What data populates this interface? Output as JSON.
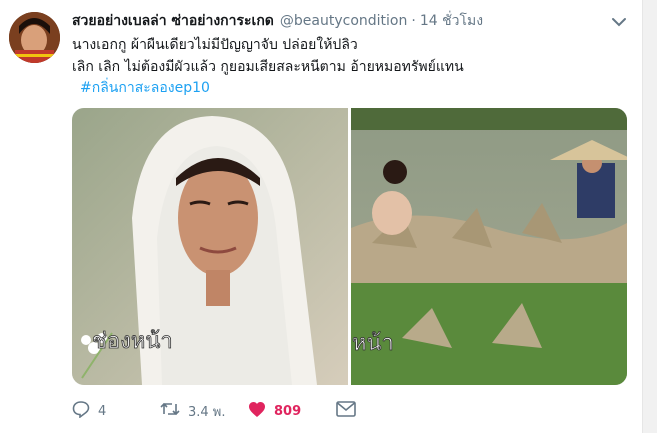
{
  "tweet": {
    "author_name": "สวยอย่างเบลล่า ซ่าอย่างการะเกด",
    "handle": "@beautycondition",
    "separator": "·",
    "time": "14 ชั่วโมง",
    "text_line1": "นางเอกกู ผ้าผืนเดียวไม่มีปัญญาจับ  ปล่อยให้ปลิว",
    "text_line2": "เลิก เลิก   ไม่ต้องมีผัวแล้ว  กูยอมเสียสละหนีตาม  อ้ายหมอทรัพย์แทน",
    "hashtag": "#กลิ่นกาสะลองep10"
  },
  "media": {
    "left_caption": "ช่องหน้า",
    "right_caption": "หน้า"
  },
  "actions": {
    "reply_count": "4",
    "retweet_count": "3.4 พ.",
    "like_count": "809"
  },
  "colors": {
    "link": "#1da1f2",
    "like": "#e0245e",
    "muted": "#657786"
  },
  "icons": [
    "avatar",
    "caret-down-icon",
    "reply-icon",
    "retweet-icon",
    "heart-icon",
    "message-icon"
  ]
}
